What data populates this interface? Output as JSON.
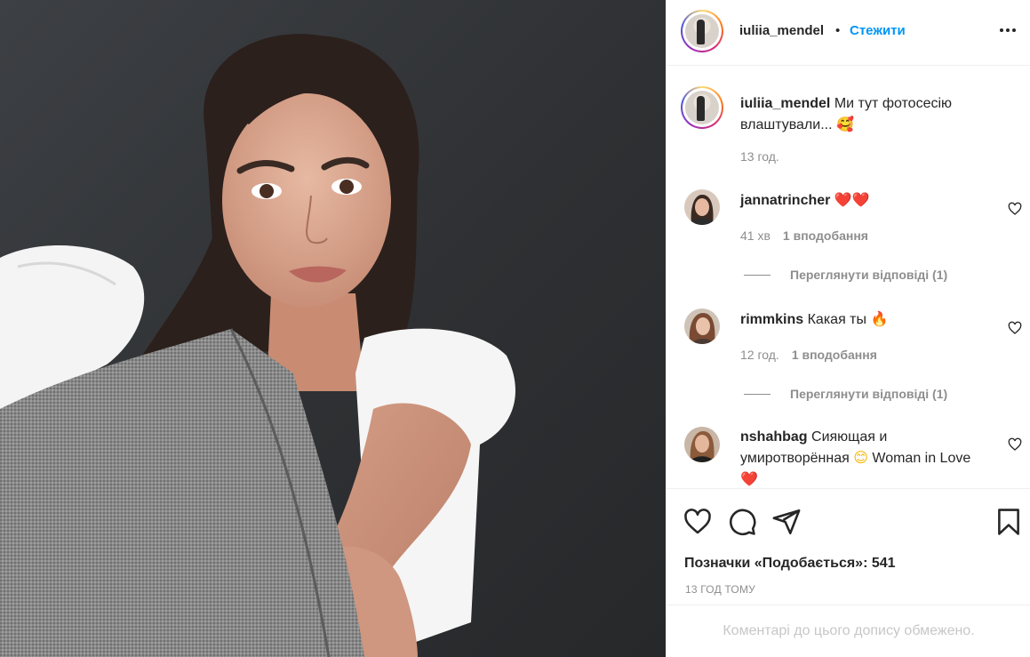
{
  "post": {
    "username": "iuliia_mendel",
    "separator": "•",
    "follow_label": "Стежити",
    "more_icon": "more-horizontal-icon"
  },
  "caption": {
    "username": "iuliia_mendel",
    "text": "Ми тут фотосесію влаштували...",
    "emoji": "🥰",
    "time": "13 год."
  },
  "comments": [
    {
      "username": "jannatrincher",
      "text": "",
      "emoji": "❤️❤️",
      "time": "41 хв",
      "likes": "1 вподобання",
      "replies": "Переглянути відповіді (1)"
    },
    {
      "username": "rimmkins",
      "text": "Какая ты",
      "emoji": "🔥",
      "time": "12 год.",
      "likes": "1 вподобання",
      "replies": "Переглянути відповіді (1)"
    },
    {
      "username": "nshahbag",
      "text": "Сияющая и умиротворённая",
      "emoji": "😊",
      "text2": "Woman in Love",
      "emoji2": "❤️"
    }
  ],
  "actions": {
    "like_icon": "heart-icon",
    "comment_icon": "comment-icon",
    "share_icon": "send-icon",
    "save_icon": "bookmark-icon"
  },
  "likes_text": "Позначки «Подобається»: 541",
  "post_time": "13 ГОД ТОМУ",
  "comments_limited": "Коментарі до цього допису обмежено.",
  "colors": {
    "accent": "#0095f6",
    "text": "#262626",
    "muted": "#8e8e8e",
    "border": "#efefef"
  }
}
